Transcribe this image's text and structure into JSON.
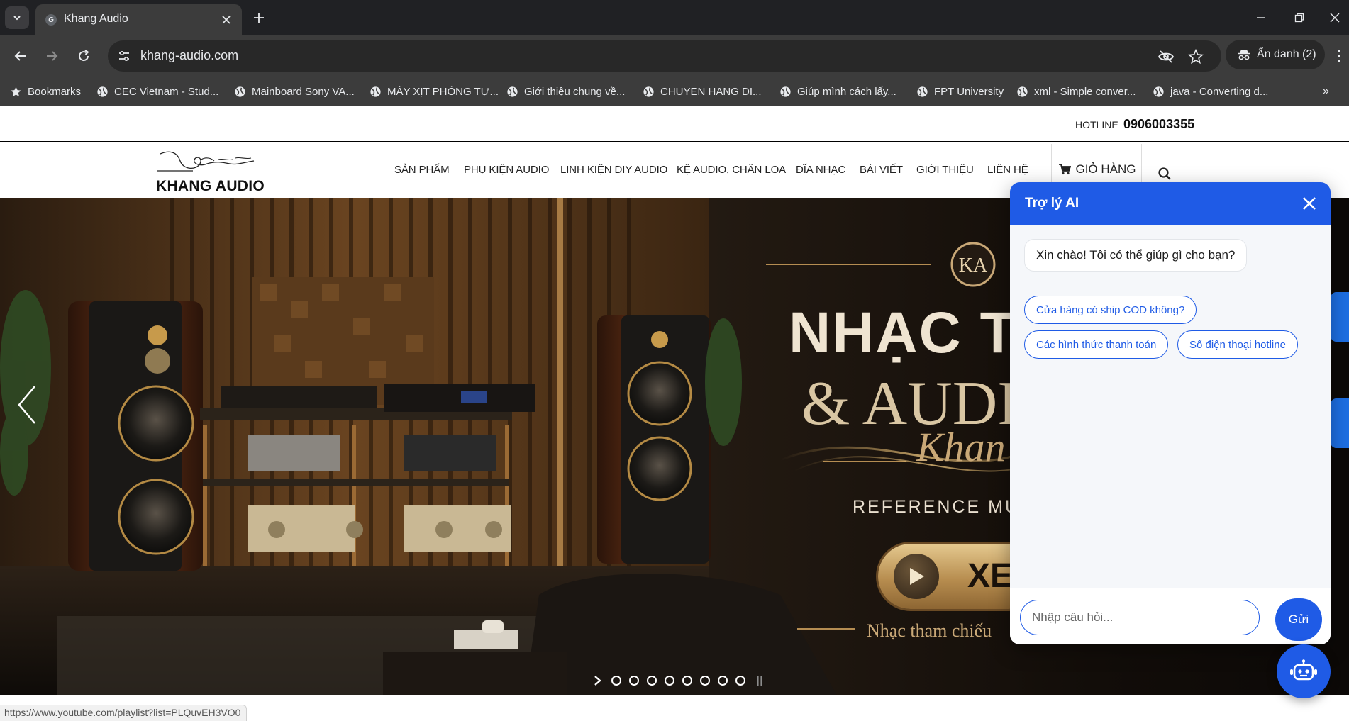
{
  "browser": {
    "tab_title": "Khang Audio",
    "url": "khang-audio.com",
    "incognito_label": "Ẩn danh (2)",
    "bookmarks": [
      "Bookmarks",
      "CEC Vietnam - Stud...",
      "Mainboard Sony VA...",
      "MÁY XỊT PHÒNG TỰ...",
      "Giới thiệu chung về...",
      "CHUYEN HANG DI...",
      "Giúp mình cách lấy...",
      "FPT University",
      "xml - Simple conver...",
      "java - Converting d..."
    ],
    "bookmarks_more": "»",
    "status_url": "https://www.youtube.com/playlist?list=PLQuvEH3VO0"
  },
  "site": {
    "hotline_label": "HOTLINE",
    "hotline_number": "0906003355",
    "logo_text": "KHANG AUDIO",
    "nav": [
      "SẢN PHẨM",
      "PHỤ KIỆN AUDIO",
      "LINH KIỆN DIY AUDIO",
      "KỆ AUDIO, CHÂN LOA",
      "ĐĨA NHẠC",
      "BÀI VIẾT",
      "GIỚI THIỆU",
      "LIÊN HỆ"
    ],
    "cart_label": "GIỎ HÀNG"
  },
  "hero": {
    "headline_line1": "NHẠC T",
    "headline_line2": "& AUDI",
    "script_text": "Khan",
    "reference_text": "REFERENCE MUS",
    "cta_label": "XEM",
    "subtitle": "Nhạc tham chiếu",
    "slide_count": 8,
    "monogram": "KA"
  },
  "chat": {
    "title": "Trợ lý AI",
    "greeting": "Xin chào! Tôi có thể giúp gì cho bạn?",
    "suggestions": [
      "Cửa hàng có ship COD không?",
      "Các hình thức thanh toán",
      "Số điện thoại hotline"
    ],
    "input_placeholder": "Nhập câu hỏi...",
    "send_label": "Gửi"
  },
  "colors": {
    "chat_accent": "#1f5be6",
    "browser_dark": "#202124",
    "toolbar": "#3c3c3c"
  }
}
